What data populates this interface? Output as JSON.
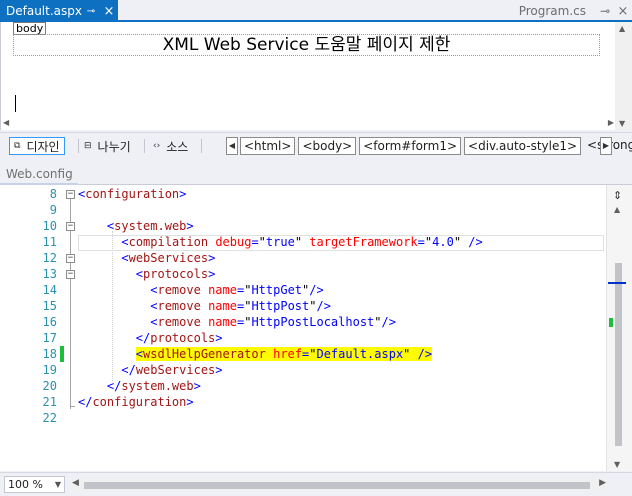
{
  "tabs": {
    "active": {
      "label": "Default.aspx",
      "pin": "⊸",
      "close": "×"
    },
    "inactive": {
      "label": "Program.cs",
      "pin": "⊸",
      "close": "×"
    }
  },
  "design": {
    "body_tag": "body",
    "page_heading": "XML Web Service 도움말 페이지 제한"
  },
  "viewbar": {
    "design_label": "디자인",
    "split_label": "나누기",
    "source_label": "소스",
    "breadcrumbs": [
      "<html>",
      "<body>",
      "<form#form1>",
      "<div.auto-style1>",
      "<strong>"
    ]
  },
  "editor": {
    "tab_label": "Web.config",
    "lines": [
      {
        "n": "8",
        "text": "<configuration>"
      },
      {
        "n": "9",
        "text": ""
      },
      {
        "n": "10",
        "text": "    <system.web>"
      },
      {
        "n": "11",
        "text": "      <compilation debug=\"true\" targetFramework=\"4.0\" />"
      },
      {
        "n": "12",
        "text": "      <webServices>"
      },
      {
        "n": "13",
        "text": "        <protocols>"
      },
      {
        "n": "14",
        "text": "          <remove name=\"HttpGet\"/>"
      },
      {
        "n": "15",
        "text": "          <remove name=\"HttpPost\"/>"
      },
      {
        "n": "16",
        "text": "          <remove name=\"HttpPostLocalhost\"/>"
      },
      {
        "n": "17",
        "text": "        </protocols>"
      },
      {
        "n": "18",
        "text": "        <wsdlHelpGenerator href=\"Default.aspx\" />"
      },
      {
        "n": "19",
        "text": "      </webServices>"
      },
      {
        "n": "20",
        "text": "    </system.web>"
      },
      {
        "n": "21",
        "text": "</configuration>"
      },
      {
        "n": "22",
        "text": ""
      }
    ],
    "highlight_color": "#fffb00",
    "changed_line_color": "#1bbf3b"
  },
  "status": {
    "zoom": "100 %"
  },
  "colors": {
    "accent": "#0e70c0",
    "keyword": "#0000ff",
    "element": "#a31515",
    "attribute": "#ff0000",
    "line_number": "#2b91af"
  }
}
